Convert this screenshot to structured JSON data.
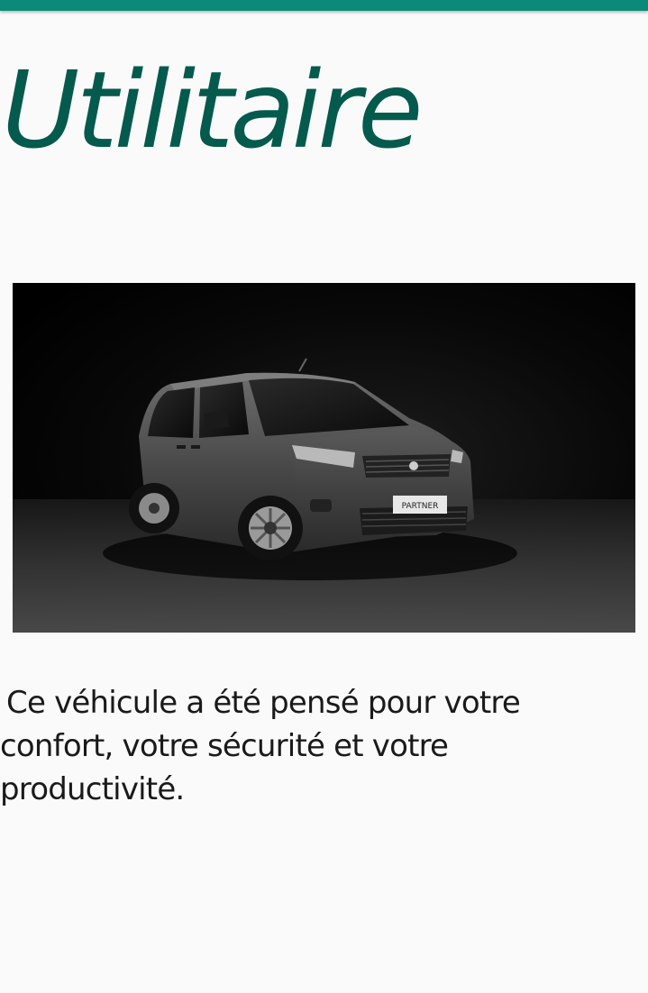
{
  "page": {
    "title": "Utilitaire",
    "description": "Ce véhicule a été pensé pour votre confort, votre sécurité et votre productivité."
  },
  "image": {
    "plate_text": "PARTNER"
  },
  "colors": {
    "accent": "#0b8a7a",
    "title": "#045a4d",
    "background": "#fafafa"
  }
}
